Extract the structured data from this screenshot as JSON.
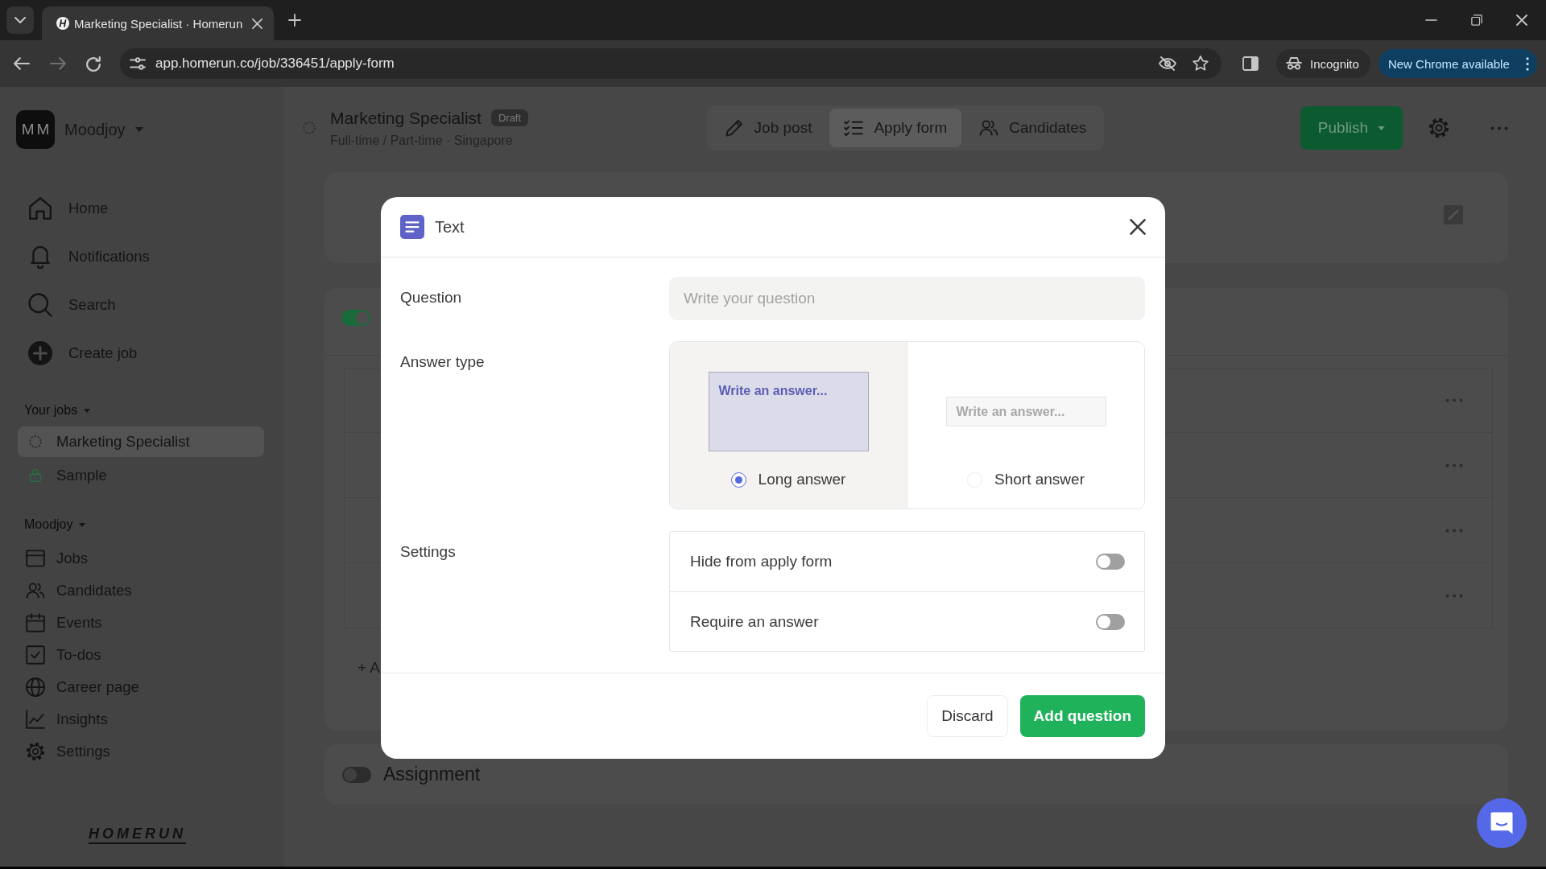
{
  "browser": {
    "tab_title": "Marketing Specialist · Homerun",
    "url": "app.homerun.co/job/336451/apply-form",
    "profile_label": "Incognito",
    "update_button": "New Chrome available"
  },
  "sidebar": {
    "workspace": {
      "initials": "MM",
      "name": "Moodjoy"
    },
    "nav": [
      {
        "label": "Home"
      },
      {
        "label": "Notifications"
      },
      {
        "label": "Search"
      },
      {
        "label": "Create job"
      }
    ],
    "your_jobs": {
      "heading": "Your jobs",
      "items": [
        {
          "label": "Marketing Specialist",
          "kind": "draft",
          "selected": true
        },
        {
          "label": "Sample",
          "kind": "sample",
          "selected": false
        }
      ]
    },
    "company": {
      "heading": "Moodjoy",
      "items": [
        {
          "label": "Jobs"
        },
        {
          "label": "Candidates"
        },
        {
          "label": "Events"
        },
        {
          "label": "To-dos"
        },
        {
          "label": "Career page"
        },
        {
          "label": "Insights"
        },
        {
          "label": "Settings"
        }
      ]
    },
    "logo": "HOMERUN"
  },
  "header": {
    "title": "Marketing Specialist",
    "badge": "Draft",
    "subtitle": "Full-time / Part-time · Singapore",
    "tabs": [
      {
        "label": "Job post",
        "selected": false
      },
      {
        "label": "Apply form",
        "selected": true
      },
      {
        "label": "Candidates",
        "selected": false
      }
    ],
    "publish_button": "Publish"
  },
  "form": {
    "questions_section": {
      "on": true
    },
    "add_link": "+ A",
    "assignment": {
      "label": "Assignment",
      "on": false
    }
  },
  "modal": {
    "title": "Text",
    "question": {
      "label": "Question",
      "placeholder": "Write your question"
    },
    "answer_type": {
      "label": "Answer type",
      "options": [
        {
          "kind": "long",
          "preview": "Write an answer...",
          "label": "Long answer",
          "selected": true
        },
        {
          "kind": "short",
          "preview": "Write an answer...",
          "label": "Short answer",
          "selected": false
        }
      ]
    },
    "settings": {
      "label": "Settings",
      "items": [
        {
          "label": "Hide from apply form",
          "on": false
        },
        {
          "label": "Require an answer",
          "on": false
        }
      ]
    },
    "buttons": [
      {
        "kind": "secondary",
        "label": "Discard"
      },
      {
        "kind": "primary",
        "label": "Add question"
      }
    ]
  }
}
